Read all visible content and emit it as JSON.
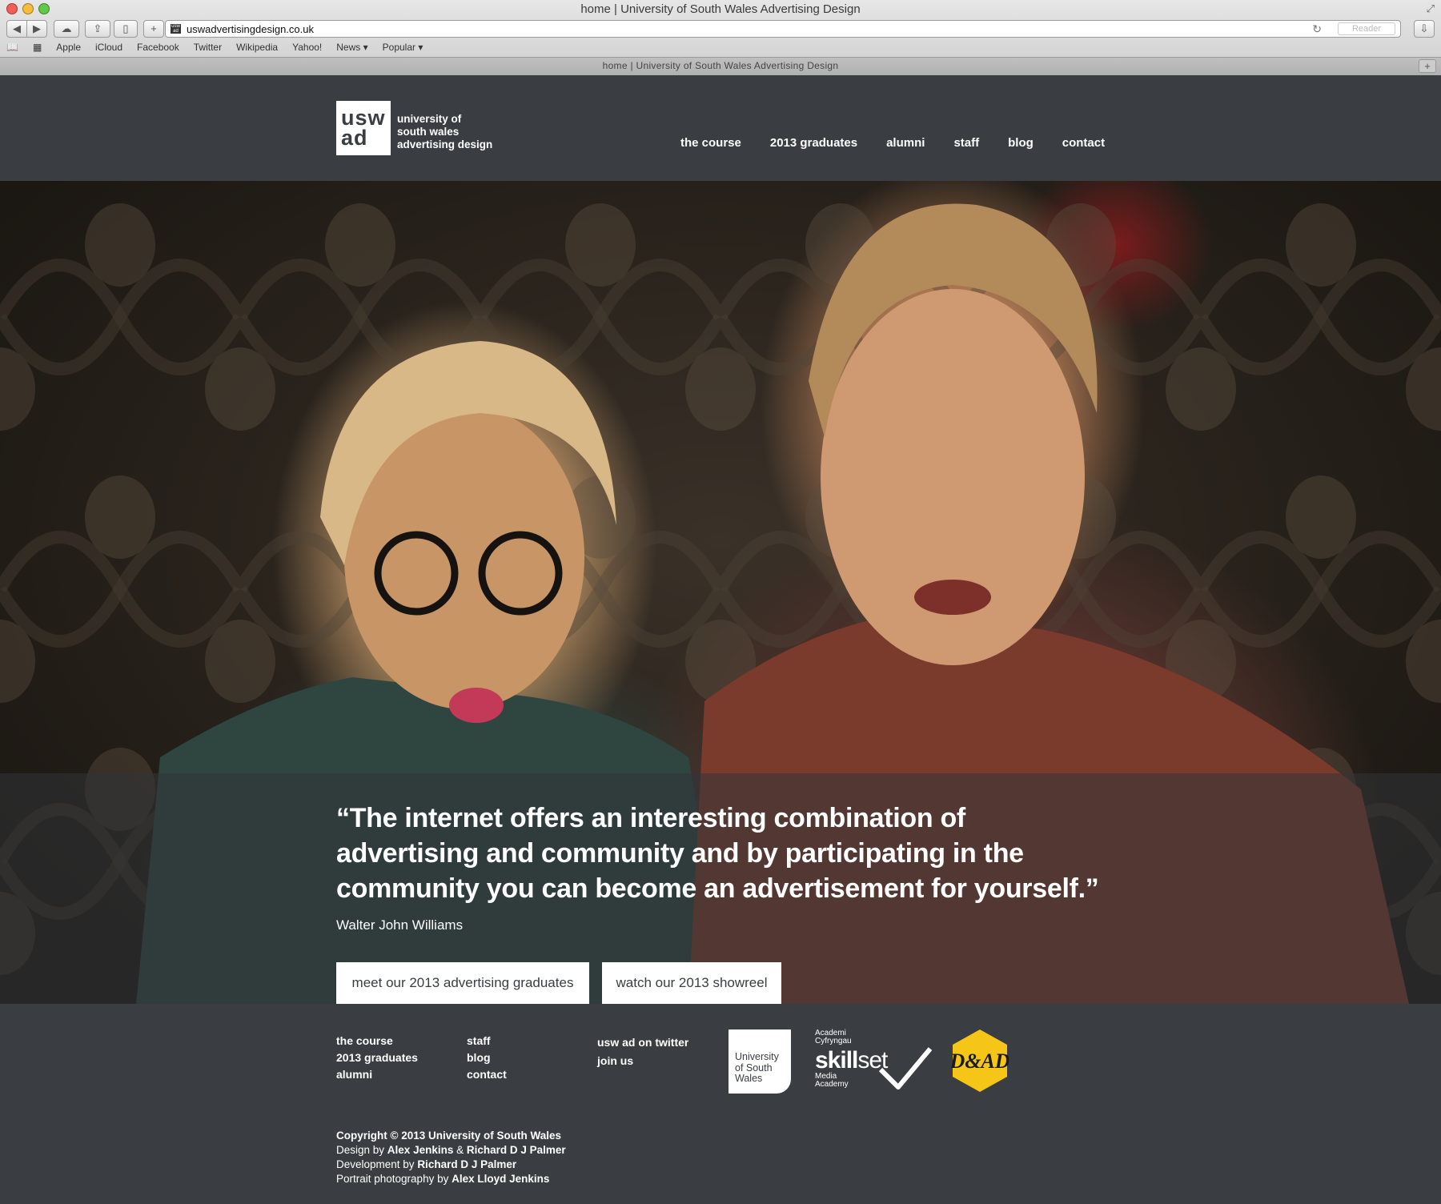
{
  "browser": {
    "window_title": "home | University of South Wales Advertising Design",
    "url": "uswadvertisingdesign.co.uk",
    "reader_label": "Reader",
    "favicon_text": "usw ad",
    "bookmarks": [
      "Apple",
      "iCloud",
      "Facebook",
      "Twitter",
      "Wikipedia",
      "Yahoo!",
      "News ▾",
      "Popular ▾"
    ],
    "tab_title": "home | University of South Wales Advertising Design"
  },
  "header": {
    "logo_line1": "usw",
    "logo_line2": "ad",
    "logo_text_1": "university of",
    "logo_text_2": "south wales",
    "logo_text_3": "advertising design",
    "nav": [
      "the course",
      "2013 graduates",
      "alumni",
      "staff",
      "blog",
      "contact"
    ]
  },
  "hero": {
    "quote": "“The internet offers an interesting combination of advertising and community and by participating in the community you can become an advertisement for yourself.”",
    "author": "Walter John Williams",
    "button_graduates": "meet our 2013 advertising graduates",
    "button_showreel": "watch our 2013 showreel"
  },
  "footer": {
    "col1": [
      "the course",
      "2013 graduates",
      "alumni"
    ],
    "col2": [
      "staff",
      "blog",
      "contact"
    ],
    "col3": [
      "usw ad on twitter",
      "join us"
    ],
    "usw_logo": [
      "University",
      "of South",
      "Wales"
    ],
    "skillset_top": [
      "Academi",
      "Cyfryngau"
    ],
    "skillset_bold": "skill",
    "skillset_light": "set",
    "skillset_bottom": [
      "Media",
      "Academy"
    ],
    "credits": [
      {
        "label": "",
        "name": "Copyright © 2013 University of South Wales"
      },
      {
        "label": "Design by ",
        "name": "Alex Jenkins",
        "and": " & ",
        "name2": "Richard D J Palmer"
      },
      {
        "label": "Development by ",
        "name": "Richard D J Palmer"
      },
      {
        "label": "Portrait photography by ",
        "name": "Alex Lloyd Jenkins"
      }
    ]
  },
  "colors": {
    "header_bg": "#3a3d41",
    "dad_yellow": "#f5c518"
  }
}
